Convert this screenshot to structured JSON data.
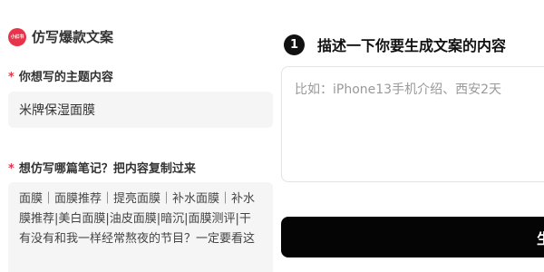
{
  "header": {
    "logo_text": "小红书",
    "title": "仿写爆款文案"
  },
  "form": {
    "topic": {
      "required_mark": "*",
      "label": "你想写的主题内容",
      "value": "米牌保湿面膜"
    },
    "reference": {
      "required_mark": "*",
      "label": "想仿写哪篇笔记？把内容复制过来",
      "lines": [
        "面膜｜面膜推荐｜提亮面膜｜补水面膜｜补水",
        "膜推荐|美白面膜|油皮面膜|暗沉|面膜测评|干",
        "有没有和我一样经常熬夜的节目？一定要看这"
      ]
    }
  },
  "step": {
    "number": "1",
    "title": "描述一下你要生成文案的内容"
  },
  "prompt": {
    "placeholder": "比如：iPhone13手机介绍、西安2天"
  },
  "generate": {
    "label": "生"
  }
}
